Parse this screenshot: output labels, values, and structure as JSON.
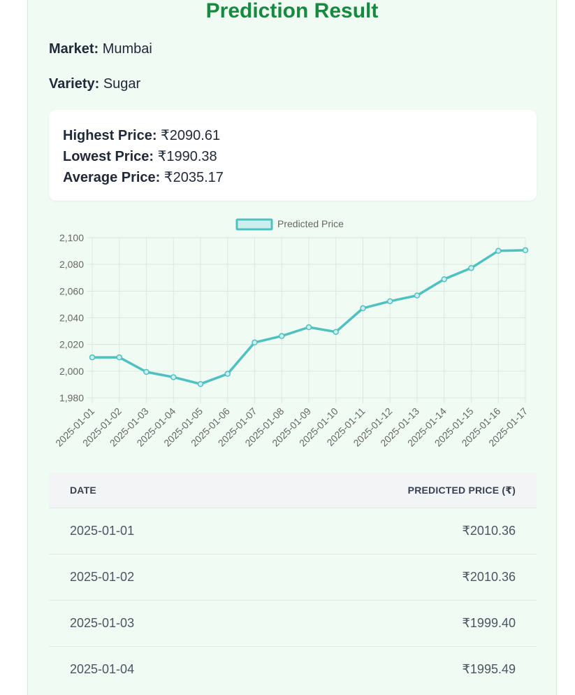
{
  "result": {
    "title": "Prediction Result",
    "market_label": "Market:",
    "market_value": "Mumbai",
    "variety_label": "Variety:",
    "variety_value": "Sugar"
  },
  "stats": {
    "highest_label": "Highest Price:",
    "highest_value": "₹2090.61",
    "lowest_label": "Lowest Price:",
    "lowest_value": "₹1990.38",
    "average_label": "Average Price:",
    "average_value": "₹2035.17"
  },
  "chart_data": {
    "type": "line",
    "title": "",
    "xlabel": "",
    "ylabel": "",
    "legend_position": "top",
    "grid": true,
    "ylim": [
      1980,
      2100
    ],
    "yticks": [
      "1,980",
      "2,000",
      "2,020",
      "2,040",
      "2,060",
      "2,080",
      "2,100"
    ],
    "categories": [
      "2025-01-01",
      "2025-01-02",
      "2025-01-03",
      "2025-01-04",
      "2025-01-05",
      "2025-01-06",
      "2025-01-07",
      "2025-01-08",
      "2025-01-09",
      "2025-01-10",
      "2025-01-11",
      "2025-01-12",
      "2025-01-13",
      "2025-01-14",
      "2025-01-15",
      "2025-01-16",
      "2025-01-17"
    ],
    "series": [
      {
        "name": "Predicted Price",
        "color": "#4fc1c0",
        "fill": "#cdeeee",
        "values": [
          2010.36,
          2010.36,
          1999.4,
          1995.49,
          1990.38,
          1998.0,
          2021.5,
          2026.3,
          2032.9,
          2029.4,
          2047.2,
          2052.4,
          2056.7,
          2068.9,
          2077.3,
          2090.2,
          2090.61
        ]
      }
    ]
  },
  "table": {
    "col_date": "Date",
    "col_price": "Predicted Price (₹)",
    "rows": [
      {
        "date": "2025-01-01",
        "price": "₹2010.36"
      },
      {
        "date": "2025-01-02",
        "price": "₹2010.36"
      },
      {
        "date": "2025-01-03",
        "price": "₹1999.40"
      },
      {
        "date": "2025-01-04",
        "price": "₹1995.49"
      }
    ]
  },
  "colors": {
    "accent": "#168a3e",
    "panel_bg": "#effbf3",
    "line": "#4fc1c0"
  }
}
